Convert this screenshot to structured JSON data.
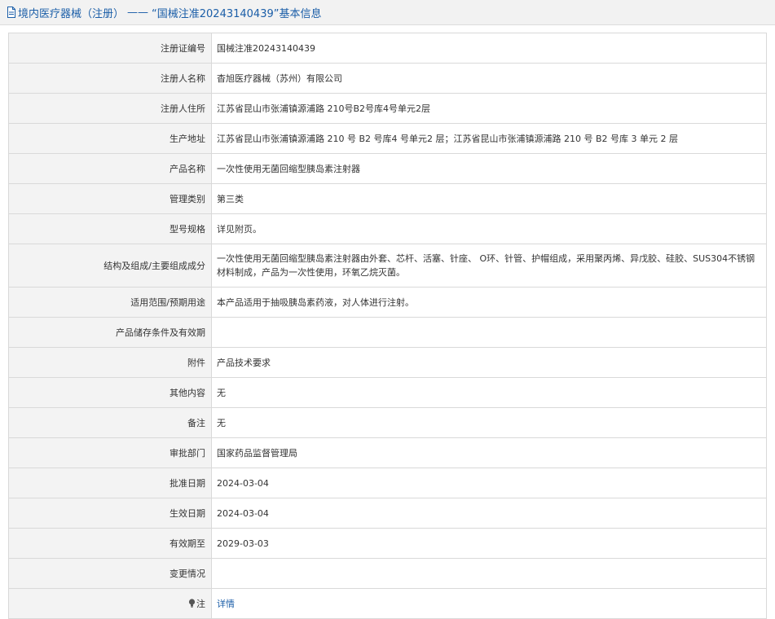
{
  "header": {
    "category": "境内医疗器械（注册）",
    "separator": "——",
    "title": "“国械注准20243140439”基本信息"
  },
  "rows": [
    {
      "label": "注册证编号",
      "value": "国械注准20243140439"
    },
    {
      "label": "注册人名称",
      "value": "杳旭医疗器械（苏州）有限公司"
    },
    {
      "label": "注册人住所",
      "value": "江苏省昆山市张浦镇源浦路 210号B2号库4号单元2层"
    },
    {
      "label": "生产地址",
      "value": "江苏省昆山市张浦镇源浦路 210 号 B2 号库4 号单元2 层；江苏省昆山市张浦镇源浦路 210 号 B2 号库 3 单元 2 层"
    },
    {
      "label": "产品名称",
      "value": "一次性使用无菌回缩型胰岛素注射器"
    },
    {
      "label": "管理类别",
      "value": "第三类"
    },
    {
      "label": "型号规格",
      "value": "详见附页。"
    },
    {
      "label": "结构及组成/主要组成成分",
      "value": "一次性使用无菌回缩型胰岛素注射器由外套、芯杆、活塞、针座、 O环、针管、护帽组成，采用聚丙烯、异戊胶、硅胶、SUS304不锈钢材料制成，产品为一次性使用，环氧乙烷灭菌。"
    },
    {
      "label": "适用范围/预期用途",
      "value": "本产品适用于抽吸胰岛素药液，对人体进行注射。"
    },
    {
      "label": "产品储存条件及有效期",
      "value": ""
    },
    {
      "label": "附件",
      "value": "产品技术要求"
    },
    {
      "label": "其他内容",
      "value": "无"
    },
    {
      "label": "备注",
      "value": "无"
    },
    {
      "label": "审批部门",
      "value": "国家药品监督管理局"
    },
    {
      "label": "批准日期",
      "value": "2024-03-04"
    },
    {
      "label": "生效日期",
      "value": "2024-03-04"
    },
    {
      "label": "有效期至",
      "value": "2029-03-03"
    },
    {
      "label": "变更情况",
      "value": ""
    }
  ],
  "note": {
    "label": "注",
    "link": "详情",
    "icon": "lightbulb-icon"
  },
  "colors": {
    "link": "#1b5ea8",
    "label_bg": "#f3f3f3",
    "border": "#d9d9d9"
  }
}
